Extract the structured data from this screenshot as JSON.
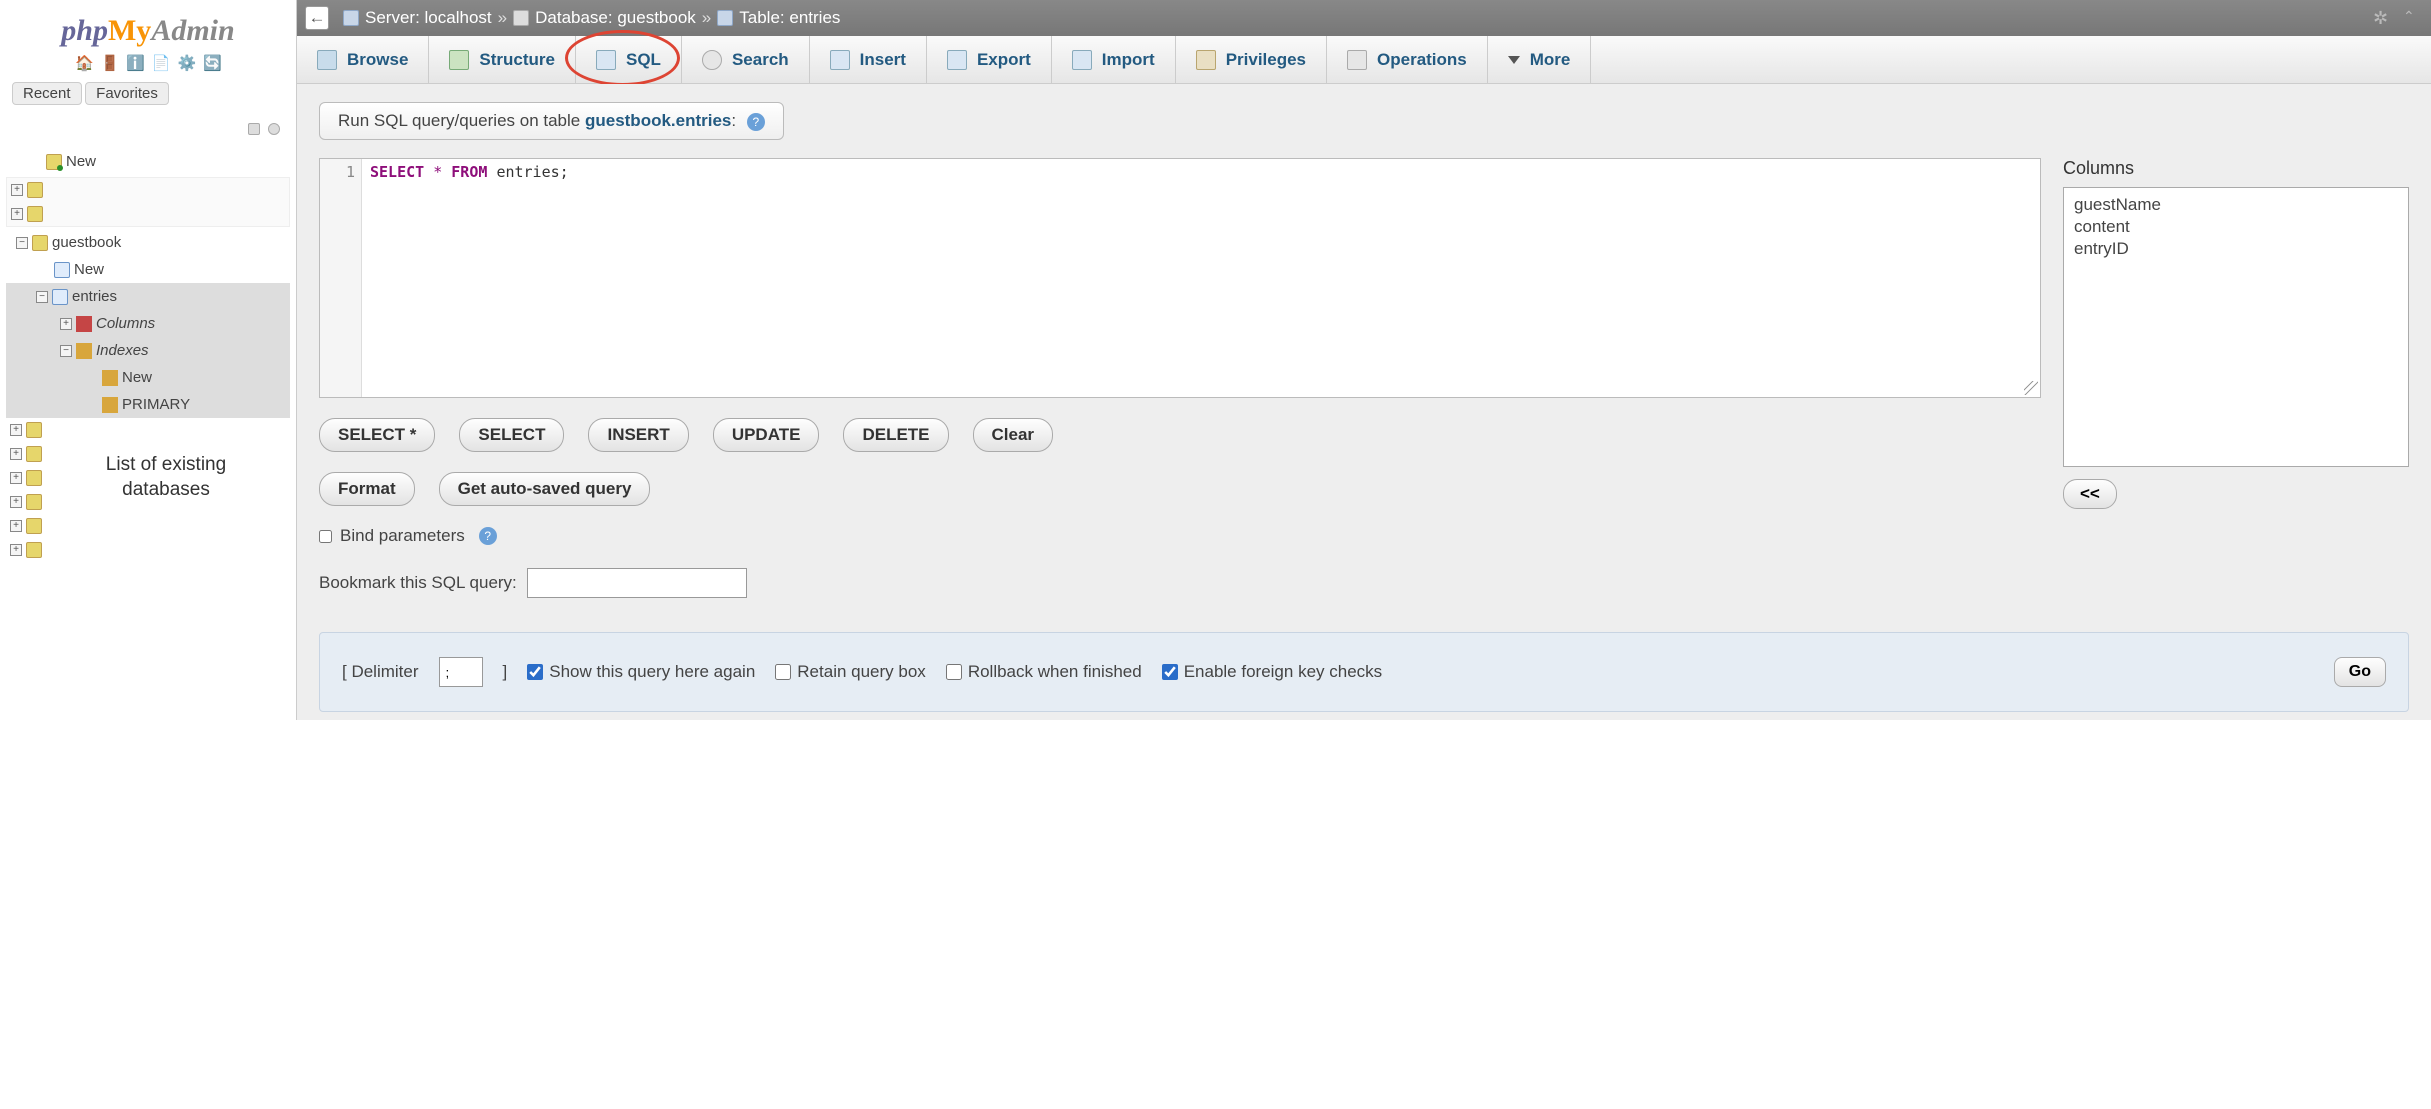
{
  "logo": {
    "p1": "php",
    "p2": "My",
    "p3": "Admin"
  },
  "sidebar": {
    "buttons": {
      "recent": "Recent",
      "favorites": "Favorites"
    },
    "tree": {
      "new_top": "New",
      "db": "guestbook",
      "db_new": "New",
      "table": "entries",
      "columns": "Columns",
      "indexes": "Indexes",
      "idx_new": "New",
      "idx_primary": "PRIMARY"
    },
    "note_line1": "List of existing",
    "note_line2": "databases"
  },
  "breadcrumb": {
    "server_label": "Server:",
    "server_value": "localhost",
    "db_label": "Database:",
    "db_value": "guestbook",
    "table_label": "Table:",
    "table_value": "entries",
    "sep": "»"
  },
  "tabs": {
    "browse": "Browse",
    "structure": "Structure",
    "sql": "SQL",
    "search": "Search",
    "insert": "Insert",
    "export": "Export",
    "import": "Import",
    "privileges": "Privileges",
    "operations": "Operations",
    "more": "More"
  },
  "panel": {
    "title_prefix": "Run SQL query/queries on table ",
    "title_link": "guestbook.entries",
    "title_suffix": ":"
  },
  "editor": {
    "line_no": "1",
    "kw_select": "SELECT",
    "star": "*",
    "kw_from": "FROM",
    "ident": "entries",
    "semicolon": ";"
  },
  "buttons": {
    "select_all": "SELECT *",
    "select": "SELECT",
    "insert": "INSERT",
    "update": "UPDATE",
    "delete": "DELETE",
    "clear": "Clear",
    "format": "Format",
    "autosaved": "Get auto-saved query",
    "insert_col": "<<",
    "go": "Go"
  },
  "checks": {
    "bind_params": "Bind parameters",
    "show_again": "Show this query here again",
    "retain_box": "Retain query box",
    "rollback": "Rollback when finished",
    "foreign_keys": "Enable foreign key checks"
  },
  "labels": {
    "bookmark": "Bookmark this SQL query:",
    "columns": "Columns",
    "delimiter_open": "[ Delimiter",
    "delimiter_close": "]",
    "delimiter_value": ";"
  },
  "columns": [
    "guestName",
    "content",
    "entryID"
  ]
}
